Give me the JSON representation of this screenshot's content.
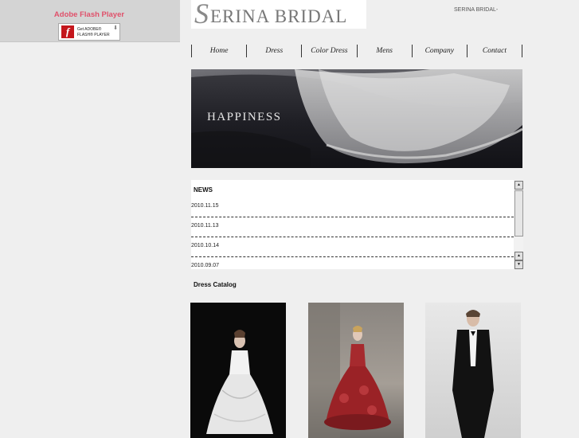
{
  "flash": {
    "title": "Adobe Flash Player",
    "badge_line1": "Get ADOBE®",
    "badge_line2": "FLASH® PLAYER",
    "icons": {
      "logo": "flash-logo-icon",
      "download": "download-arrow-icon"
    }
  },
  "header": {
    "logo_initial": "S",
    "logo_text": "ERINA BRIDAL",
    "site_label": "SERINA BRIDAL-"
  },
  "nav": {
    "items": [
      {
        "label": "Home"
      },
      {
        "label": "Dress"
      },
      {
        "label": "Color Dress"
      },
      {
        "label": "Mens"
      },
      {
        "label": "Company"
      },
      {
        "label": "Contact"
      }
    ]
  },
  "hero": {
    "text": "HAPPINESS"
  },
  "news": {
    "heading": "NEWS",
    "items": [
      "2010.11.15",
      "2010.11.13",
      "2010.10.14",
      "2010.09.07"
    ],
    "scrollbar": {
      "up_icon": "arrow-up-icon",
      "down_icon": "arrow-down-icon"
    }
  },
  "catalog": {
    "heading": "Dress Catalog",
    "items": [
      {
        "name": "white-wedding-dress"
      },
      {
        "name": "red-color-dress"
      },
      {
        "name": "mens-tuxedo"
      }
    ]
  },
  "colors": {
    "page_bg": "#efefef",
    "flash_title": "#e0506a",
    "flash_logo": "#c4161c",
    "hero_bg": "#1e1e24"
  }
}
